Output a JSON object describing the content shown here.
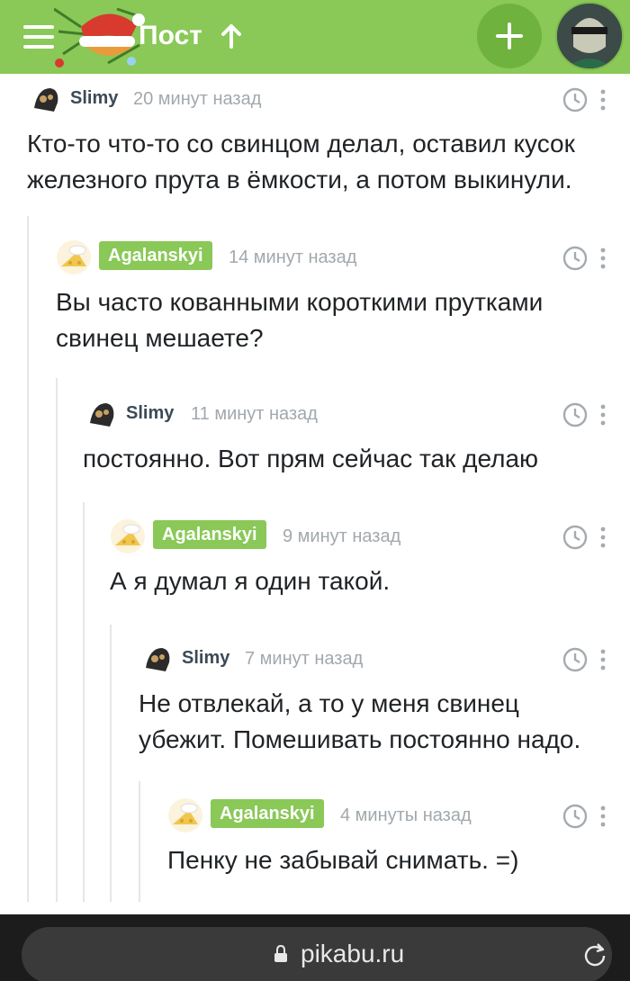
{
  "header": {
    "title": "Пост",
    "colors": {
      "bar": "#8ac858",
      "add_button": "#6fb23e"
    },
    "icons": [
      "menu-icon",
      "up-arrow-icon",
      "plus-icon",
      "user-avatar"
    ]
  },
  "comments": [
    {
      "author": "Slimy",
      "author_is_badge": false,
      "time": "20 минут назад",
      "text": "Кто-то что-то со свинцом делал, оставил кусок\nжелезного прута в ёмкости, а потом выкинули."
    },
    {
      "author": "Agalanskyi",
      "author_is_badge": true,
      "time": "14 минут назад",
      "text": "Вы часто кованными короткими прутками\nсвинец мешаете?"
    },
    {
      "author": "Slimy",
      "author_is_badge": false,
      "time": "11 минут назад",
      "text": "постоянно. Вот прям сейчас так делаю"
    },
    {
      "author": "Agalanskyi",
      "author_is_badge": true,
      "time": "9 минут назад",
      "text": "А я думал я один такой."
    },
    {
      "author": "Slimy",
      "author_is_badge": false,
      "time": "7 минут назад",
      "text": "Не отвлекай, а то у меня свинец\nубежит. Помешивать постоянно надо."
    },
    {
      "author": "Agalanskyi",
      "author_is_badge": true,
      "time": "4 минуты назад",
      "text": "Пенку не забывай снимать. =)"
    }
  ],
  "browser": {
    "url": "pikabu.ru"
  }
}
